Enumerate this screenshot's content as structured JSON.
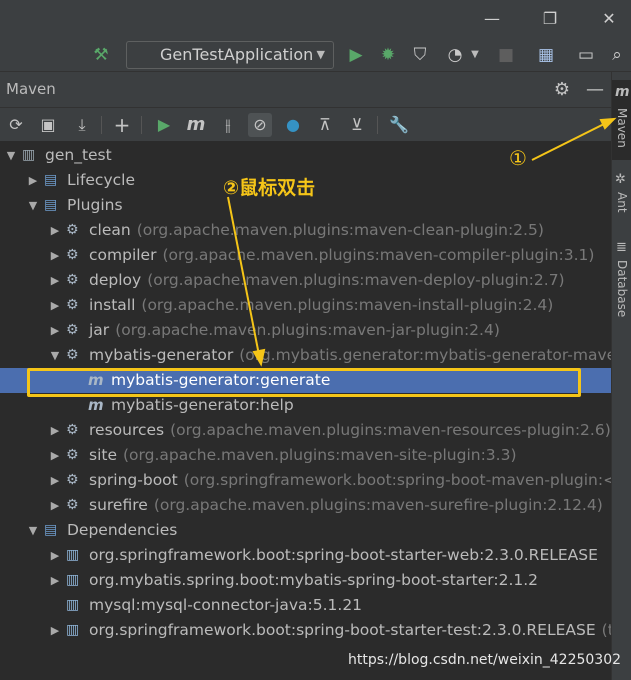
{
  "toolbar": {
    "run_config_label": "GenTestApplication",
    "icons": [
      "hammer-icon",
      "run-icon",
      "debug-icon",
      "coverage-icon",
      "profile-icon",
      "stop-icon",
      "project-structure-icon",
      "window-icon",
      "search-icon"
    ]
  },
  "maven_panel": {
    "title": "Maven",
    "toolbar_icons": [
      "reload-icon",
      "generate-sources-icon",
      "download-icon",
      "add-icon",
      "run-icon",
      "execute-goal-icon",
      "toggle-offline-icon",
      "skip-tests-icon",
      "show-dependencies-icon",
      "collapse-icon",
      "expand-icon",
      "settings-icon"
    ]
  },
  "tree": [
    {
      "label": "gen_test",
      "detail": "",
      "icon": "maven-project-icon",
      "chevron": "down",
      "selected": false
    },
    {
      "label": "Lifecycle",
      "detail": "",
      "icon": "folder-gear-icon",
      "chevron": "right",
      "selected": false
    },
    {
      "label": "Plugins",
      "detail": "",
      "icon": "folder-gear-icon",
      "chevron": "down",
      "selected": false
    },
    {
      "label": "clean",
      "detail": "(org.apache.maven.plugins:maven-clean-plugin:2.5)",
      "icon": "plugin-icon",
      "chevron": "right",
      "selected": false
    },
    {
      "label": "compiler",
      "detail": "(org.apache.maven.plugins:maven-compiler-plugin:3.1)",
      "icon": "plugin-icon",
      "chevron": "right",
      "selected": false
    },
    {
      "label": "deploy",
      "detail": "(org.apache.maven.plugins:maven-deploy-plugin:2.7)",
      "icon": "plugin-icon",
      "chevron": "right",
      "selected": false
    },
    {
      "label": "install",
      "detail": "(org.apache.maven.plugins:maven-install-plugin:2.4)",
      "icon": "plugin-icon",
      "chevron": "right",
      "selected": false
    },
    {
      "label": "jar",
      "detail": "(org.apache.maven.plugins:maven-jar-plugin:2.4)",
      "icon": "plugin-icon",
      "chevron": "right",
      "selected": false
    },
    {
      "label": "mybatis-generator",
      "detail": "(org.mybatis.generator:mybatis-generator-maven-p",
      "icon": "plugin-icon",
      "chevron": "down",
      "selected": false
    },
    {
      "label": "mybatis-generator:generate",
      "detail": "",
      "icon": "goal-icon",
      "chevron": "",
      "selected": true
    },
    {
      "label": "mybatis-generator:help",
      "detail": "",
      "icon": "goal-icon",
      "chevron": "",
      "selected": false
    },
    {
      "label": "resources",
      "detail": "(org.apache.maven.plugins:maven-resources-plugin:2.6)",
      "icon": "plugin-icon",
      "chevron": "right",
      "selected": false
    },
    {
      "label": "site",
      "detail": "(org.apache.maven.plugins:maven-site-plugin:3.3)",
      "icon": "plugin-icon",
      "chevron": "right",
      "selected": false
    },
    {
      "label": "spring-boot",
      "detail": "(org.springframework.boot:spring-boot-maven-plugin:<un",
      "icon": "plugin-icon",
      "chevron": "right",
      "selected": false
    },
    {
      "label": "surefire",
      "detail": "(org.apache.maven.plugins:maven-surefire-plugin:2.12.4)",
      "icon": "plugin-icon",
      "chevron": "right",
      "selected": false
    },
    {
      "label": "Dependencies",
      "detail": "",
      "icon": "folder-gear-icon",
      "chevron": "down",
      "selected": false
    },
    {
      "label": "org.springframework.boot:spring-boot-starter-web:2.3.0.RELEASE",
      "detail": "",
      "icon": "library-icon",
      "chevron": "right",
      "selected": false
    },
    {
      "label": "org.mybatis.spring.boot:mybatis-spring-boot-starter:2.1.2",
      "detail": "",
      "icon": "library-icon",
      "chevron": "right",
      "selected": false
    },
    {
      "label": "mysql:mysql-connector-java:5.1.21",
      "detail": "",
      "icon": "library-icon",
      "chevron": "",
      "selected": false
    },
    {
      "label": "org.springframework.boot:spring-boot-starter-test:2.3.0.RELEASE",
      "detail": "(test)",
      "icon": "library-icon",
      "chevron": "right",
      "selected": false
    }
  ],
  "side_tabs": [
    "Maven",
    "Ant",
    "Database"
  ],
  "annotations": {
    "step1": "①",
    "step2": "②鼠标双击",
    "color": "#f5c518"
  },
  "watermark": "https://blog.csdn.net/weixin_42250302",
  "colors": {
    "selection": "#4b6eaf",
    "run_green": "#59a869",
    "accent_blue": "#3592c4"
  }
}
